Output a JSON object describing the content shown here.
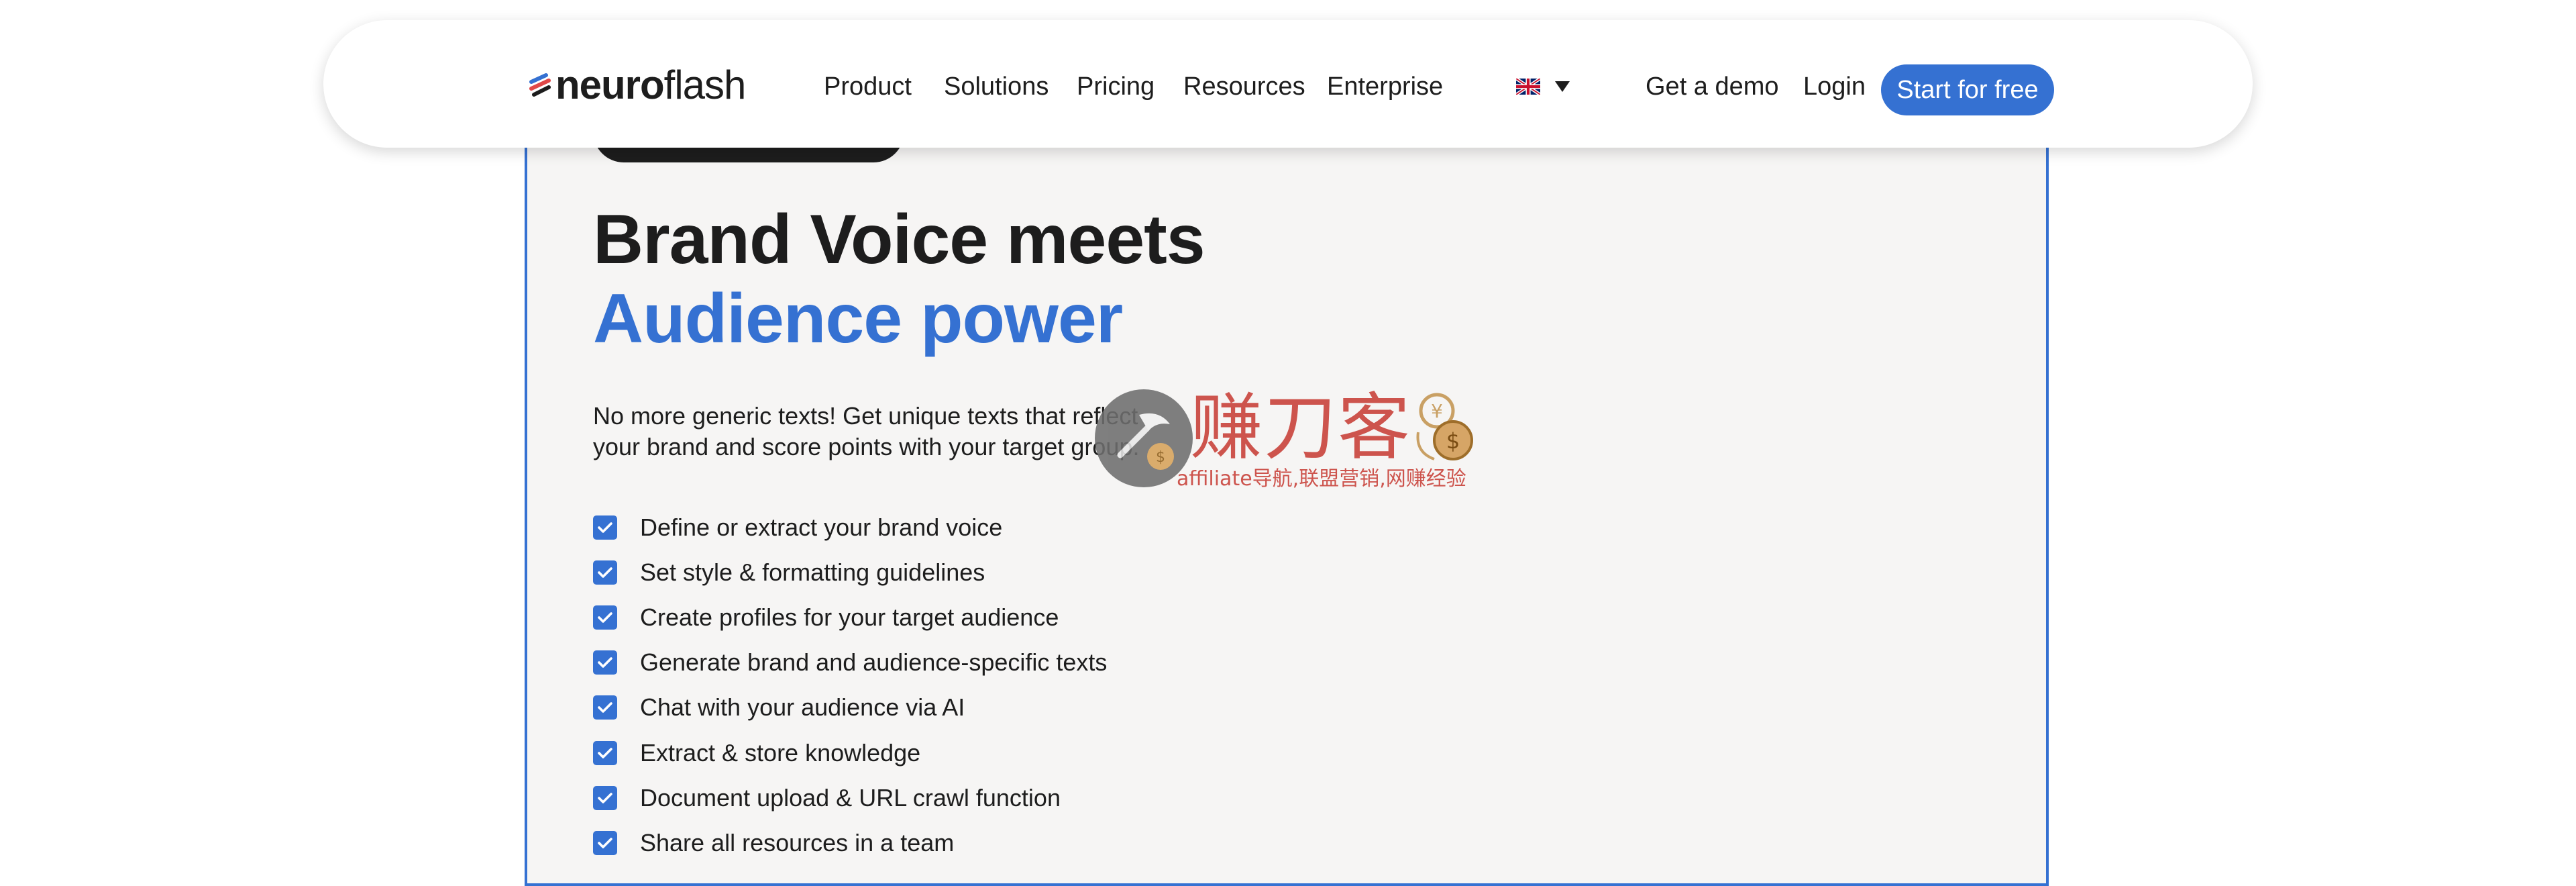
{
  "nav": {
    "logo": {
      "bold": "neuro",
      "light": "flash"
    },
    "menu": [
      {
        "label": "Product"
      },
      {
        "label": "Solutions"
      },
      {
        "label": "Pricing"
      },
      {
        "label": "Resources"
      },
      {
        "label": "Enterprise"
      }
    ],
    "language_icon": "uk-flag-icon",
    "get_demo": "Get a demo",
    "login": "Login",
    "start_free": "Start for free"
  },
  "hero": {
    "headline_line1": "Brand Voice meets",
    "headline_line2": "Audience power",
    "description_line1": "No more generic texts! Get unique texts that reflect",
    "description_line2": "your brand and score points with your target group.",
    "features": [
      "Define or extract your brand voice",
      "Set style & formatting guidelines",
      "Create profiles for your target audience",
      "Generate brand and audience-specific texts",
      "Chat with your audience via AI",
      "Extract & store knowledge",
      "Document upload & URL crawl function",
      "Share all resources in a team"
    ]
  },
  "watermark": {
    "chinese_title": "赚刀客",
    "subtitle": "affiliate导航,联盟营销,网赚经验"
  },
  "colors": {
    "accent": "#3571d2",
    "text": "#1d1d1d",
    "card_background": "#f6f5f4",
    "watermark_red": "#c9433c"
  }
}
